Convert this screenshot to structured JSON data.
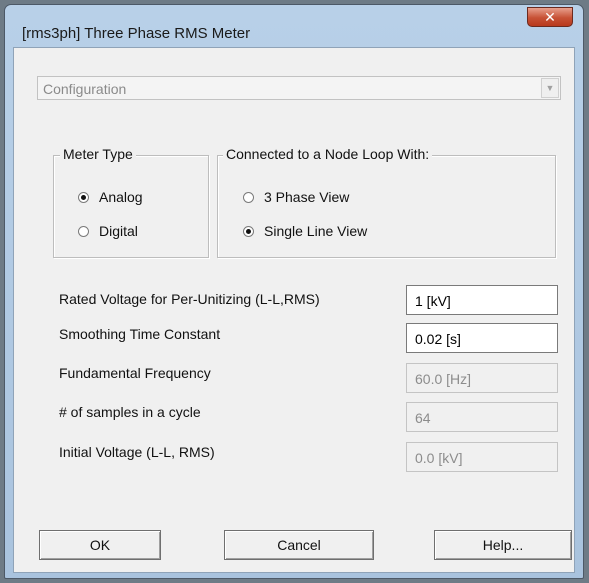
{
  "window": {
    "title": "[rms3ph] Three Phase RMS Meter",
    "close_glyph": "✕"
  },
  "section_select": {
    "value": "Configuration",
    "arrow_glyph": "▼"
  },
  "meter_type": {
    "legend": "Meter Type",
    "options": [
      {
        "label": "Analog",
        "checked": true
      },
      {
        "label": "Digital",
        "checked": false
      }
    ]
  },
  "node_loop": {
    "legend": "Connected to a Node Loop With:",
    "options": [
      {
        "label": "3 Phase View",
        "checked": false
      },
      {
        "label": "Single Line View",
        "checked": true
      }
    ]
  },
  "params": [
    {
      "label": "Rated Voltage for Per-Unitizing (L-L,RMS)",
      "value": "1 [kV]",
      "editable": true
    },
    {
      "label": "Smoothing Time Constant",
      "value": "0.02 [s]",
      "editable": true
    },
    {
      "label": "Fundamental Frequency",
      "value": "60.0 [Hz]",
      "editable": false
    },
    {
      "label": "# of samples in a cycle",
      "value": "64",
      "editable": false
    },
    {
      "label": "Initial Voltage (L-L, RMS)",
      "value": "0.0 [kV]",
      "editable": false
    }
  ],
  "buttons": {
    "ok": "OK",
    "cancel": "Cancel",
    "help": "Help..."
  }
}
